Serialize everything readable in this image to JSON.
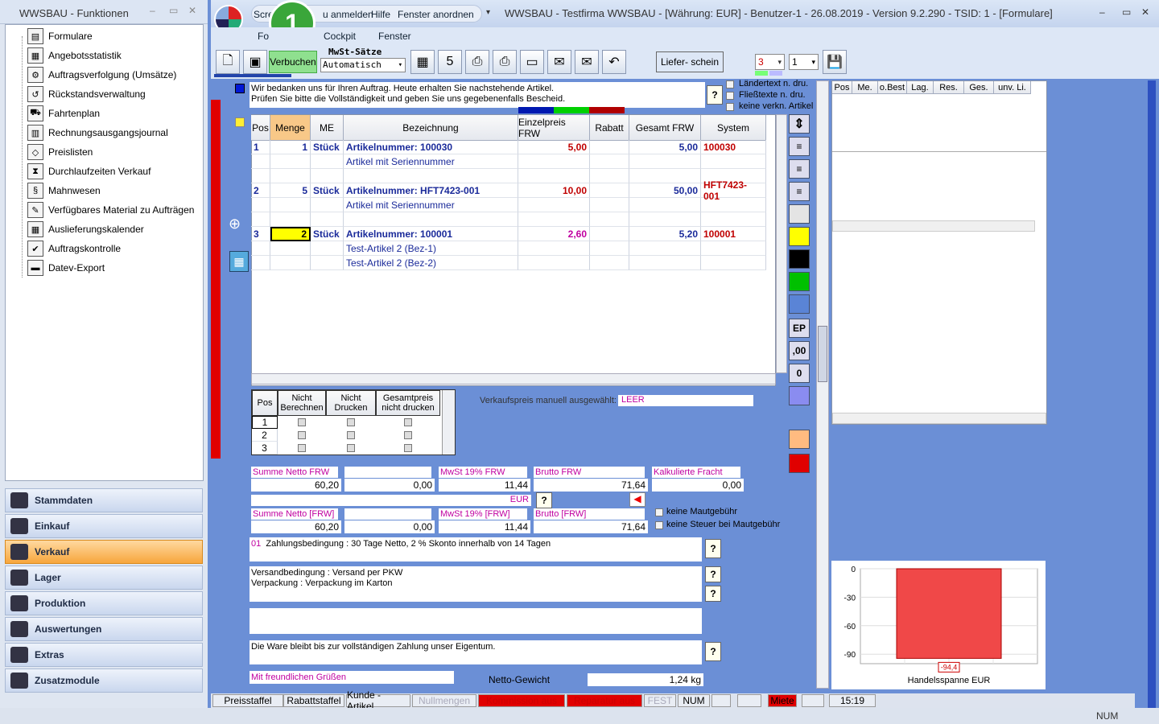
{
  "left_panel": {
    "title": "WWSBAU - Funktionen",
    "tree": [
      "Formulare",
      "Angebotsstatistik",
      "Auftragsverfolgung (Umsätze)",
      "Rückstandsverwaltung",
      "Fahrtenplan",
      "Rechnungsausgangsjournal",
      "Preislisten",
      "Durchlaufzeiten Verkauf",
      "Mahnwesen",
      "Verfügbares Material zu Aufträgen",
      "Auslieferungskalender",
      "Auftragskontrolle",
      "Datev-Export"
    ],
    "nav": [
      "Stammdaten",
      "Einkauf",
      "Verkauf",
      "Lager",
      "Produktion",
      "Auswertungen",
      "Extras",
      "Zusatzmodule"
    ]
  },
  "menu": {
    "items": [
      "Scre",
      "u anmelden",
      "Hilfe",
      "Fenster anordnen"
    ],
    "row2": [
      "Fo",
      "Cockpit",
      "Fenster"
    ],
    "badge": "1",
    "window_title": "WWSBAU - Testfirma WWSBAU - [Währung: EUR] - Benutzer-1 - 26.08.2019 - Version 9.2.290 - TSID: 1  - [Formulare]"
  },
  "toolbar": {
    "verbuchen": "Verbuchen",
    "mwst_label": "MwSt-Sätze",
    "mwst_value": "Automatisch",
    "liefer_button": "Liefer-   schein",
    "dropdown1": "3",
    "dropdown2": "1"
  },
  "header_text": {
    "line1": "Wir bedanken uns für Ihren Auftrag. Heute erhalten Sie nachstehende Artikel.",
    "line2": "Prüfen Sie bitte die Vollständigkeit und geben Sie uns gegebenenfalls Bescheid.",
    "opt1": "Ländertext n. dru.",
    "opt2": "Fließtexte n. dru.",
    "opt3": "keine verkn. Artikel"
  },
  "grid": {
    "columns": [
      "Pos",
      "Menge",
      "ME",
      "Bezeichnung",
      "Einzelpreis FRW",
      "Rabatt",
      "Gesamt FRW",
      "System"
    ],
    "rows": [
      {
        "pos": "1",
        "menge": "1",
        "me": "Stück",
        "bez": "Artikelnummer: 100030",
        "ep": "5,00",
        "gesamt": "5,00",
        "system": "100030",
        "sub": [
          "Artikel mit Seriennummer"
        ]
      },
      {
        "pos": "2",
        "menge": "5",
        "me": "Stück",
        "bez": "Artikelnummer: HFT7423-001",
        "ep": "10,00",
        "gesamt": "50,00",
        "system": "HFT7423-001",
        "sub": [
          "Artikel mit Seriennummer"
        ]
      },
      {
        "pos": "3",
        "menge": "2",
        "me": "Stück",
        "bez": "Artikelnummer: 100001",
        "ep": "2,60",
        "gesamt": "5,20",
        "system": "100001",
        "sub": [
          "Test-Artikel 2  (Bez-1)",
          "Test-Artikel 2  (Bez-2)"
        ]
      }
    ]
  },
  "sidebuttons": {
    "ep": "EP",
    "dec": ",00",
    "zero": "0"
  },
  "subgrid": {
    "columns": [
      "Pos",
      "Nicht Berechnen",
      "Nicht Drucken",
      "Gesamtpreis nicht drucken"
    ],
    "rows": [
      "1",
      "2",
      "3"
    ]
  },
  "vk": {
    "label": "Verkaufspreis manuell ausgewählt:",
    "value": "LEER"
  },
  "sums": {
    "netto_lbl": "Summe Netto FRW",
    "netto": "60,20",
    "zero": "0,00",
    "mwst_lbl": "MwSt 19% FRW",
    "mwst": "11,44",
    "brutto_lbl": "Brutto FRW",
    "brutto": "71,64",
    "fracht_lbl": "Kalkulierte Fracht",
    "fracht": "0,00",
    "currency": "EUR",
    "netto2_lbl": "Summe Netto [FRW]",
    "netto2": "60,20",
    "zero2": "0,00",
    "mwst2_lbl": "MwSt 19% [FRW]",
    "mwst2": "11,44",
    "brutto2_lbl": "Brutto [FRW]",
    "brutto2": "71,64",
    "maut": "keine Mautgebühr",
    "maut2": "keine Steuer bei Mautgebühr"
  },
  "texts": {
    "zb_code": "01",
    "zb": "Zahlungsbedingung : 30 Tage Netto, 2 % Skonto innerhalb von 14 Tagen",
    "vers1": "Versandbedingung : Versand per PKW",
    "vers2": "Verpackung :  Verpackung im Karton",
    "eigentum": "Die Ware bleibt bis zur vollständigen Zahlung unser Eigentum.",
    "gruss": "Mit freundlichen Grüßen",
    "netto_gew_lbl": "Netto-Gewicht",
    "netto_gew": "1,24 kg",
    "q": "?"
  },
  "right_table": {
    "columns": [
      "Pos",
      "Me.",
      "o.Best",
      "Lag.",
      "Res.",
      "Ges.",
      "unv. Li."
    ]
  },
  "chart_data": {
    "type": "bar",
    "categories": [
      "Handelsspanne EUR"
    ],
    "values": [
      -94.4
    ],
    "ylim": [
      -100,
      0
    ],
    "yticks": [
      "0",
      "-30",
      "-60",
      "-90"
    ],
    "xlabel": "Handelsspanne EUR",
    "data_label": "-94,4"
  },
  "status": {
    "items": [
      "Preisstaffel",
      "Rabattstaffel",
      "Kunde - Artikel",
      "Nullmengen",
      "Kommission aus",
      "Reparatur aus",
      "FEST",
      "NUM",
      "Miete",
      "15:19"
    ],
    "bottom_num": "NUM"
  },
  "colors": {
    "accent": "#6b8fd6",
    "red": "#e00000",
    "yellow": "#ffff00",
    "green": "#00c000",
    "orange": "#f7a63c"
  }
}
